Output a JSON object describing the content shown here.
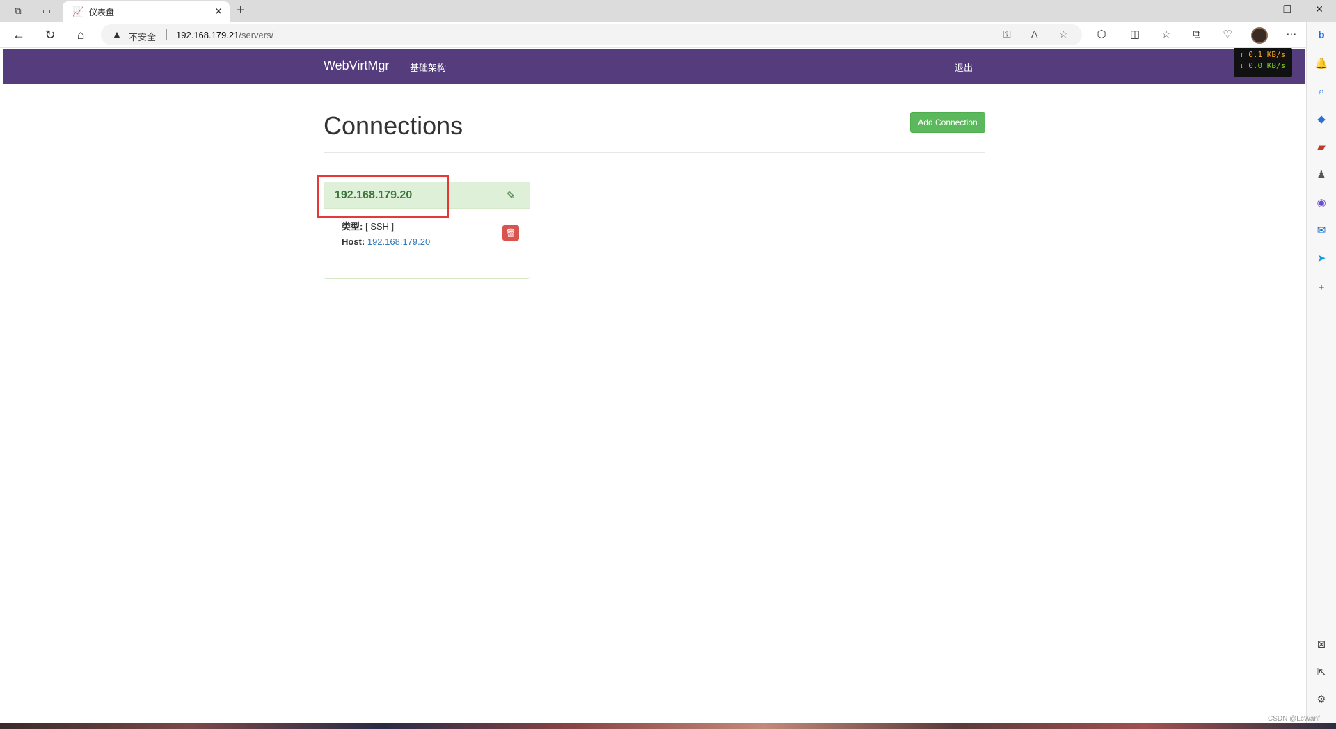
{
  "browser": {
    "tab": {
      "title": "仪表盘",
      "favicon": "dashboard-icon"
    },
    "security_label": "不安全",
    "url_host": "192.168.179.21",
    "url_path": "/servers/"
  },
  "app": {
    "brand": "WebVirtMgr",
    "nav_link": "基础架构",
    "logout": "退出",
    "accent_color": "#543c7d"
  },
  "network_monitor": {
    "upload": "↑ 0.1 KB/s",
    "download": "↓ 0.0 KB/s"
  },
  "main": {
    "title": "Connections",
    "add_button": "Add Connection"
  },
  "connections": [
    {
      "name": "192.168.179.20",
      "type_label": "类型:",
      "type_value": "[ SSH ]",
      "host_label": "Host:",
      "host_value": "192.168.179.20"
    }
  ],
  "watermark": "CSDN @LcWanf"
}
